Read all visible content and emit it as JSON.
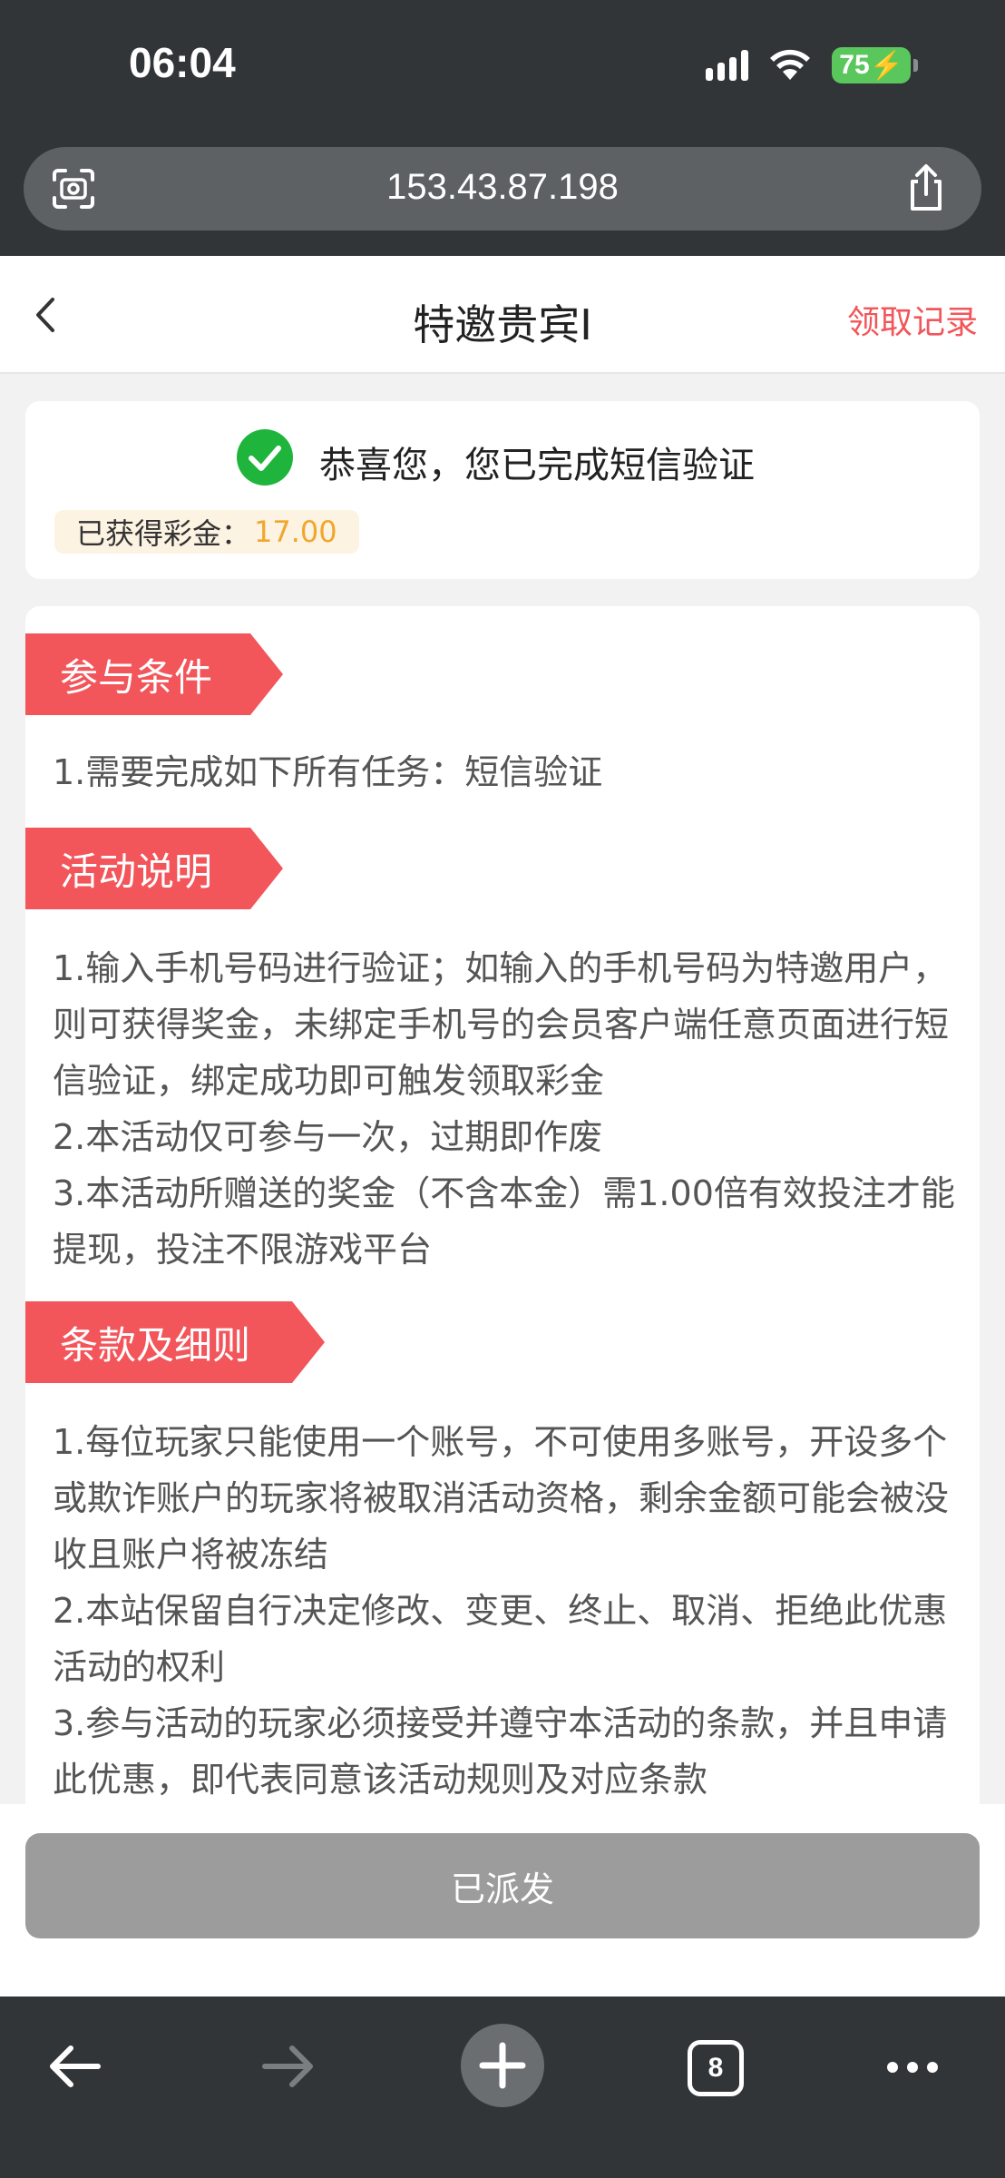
{
  "status_bar": {
    "time": "06:04",
    "battery": "75"
  },
  "browser": {
    "url": "153.43.87.198",
    "tab_count": "8"
  },
  "header": {
    "title": "特邀贵宾I",
    "record_link": "领取记录"
  },
  "success": {
    "message": "恭喜您，您已完成短信验证",
    "bonus_label": "已获得彩金：",
    "bonus_value": "17.00"
  },
  "sections": [
    {
      "title": "参与条件",
      "lines": [
        "1.需要完成如下所有任务：短信验证"
      ]
    },
    {
      "title": "活动说明",
      "lines": [
        "1.输入手机号码进行验证；如输入的手机号码为特邀用户，则可获得奖金，未绑定手机号的会员客户端任意页面进行短信验证，绑定成功即可触发领取彩金",
        "2.本活动仅可参与一次，过期即作废",
        "3.本活动所赠送的奖金（不含本金）需1.00倍有效投注才能提现，投注不限游戏平台"
      ]
    },
    {
      "title": "条款及细则",
      "lines": [
        "1.每位玩家只能使用一个账号，不可使用多账号，开设多个或欺诈账户的玩家将被取消活动资格，剩余金额可能会被没收且账户将被冻结",
        "2.本站保留自行决定修改、变更、终止、取消、拒绝此优惠活动的权利",
        "3.参与活动的玩家必须接受并遵守本活动的条款，并且申请此优惠，即代表同意该活动规则及对应条款"
      ]
    }
  ],
  "action": {
    "button_label": "已派发"
  },
  "colors": {
    "accent_red": "#f2555a",
    "bonus_orange": "#f1a62c",
    "success_green": "#1fb53d",
    "disabled_gray": "#9c9c9c"
  }
}
